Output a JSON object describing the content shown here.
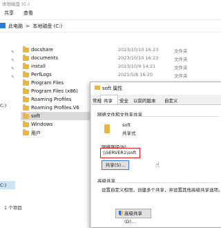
{
  "window": {
    "title": "本地磁盘 (C:)"
  },
  "ribbon": {
    "tabs": [
      "共享",
      "查看"
    ]
  },
  "address": {
    "crumbs": [
      "此电脑",
      ">",
      "本地磁盘 (C:)"
    ]
  },
  "nav": {
    "drive_top": "C:)",
    "drive_selected": "C:)"
  },
  "files": [
    {
      "name": "docshare",
      "date": "2023/10/10 16:23",
      "type": "文件夹",
      "selected": false
    },
    {
      "name": "documents",
      "date": "2023/10/10 16:23",
      "type": "文件夹",
      "selected": false
    },
    {
      "name": "install",
      "date": "2023/10/9 14:21",
      "type": "文件夹",
      "selected": false
    },
    {
      "name": "PerfLogs",
      "date": "2021/5/8 16:20",
      "type": "文件夹",
      "selected": false
    },
    {
      "name": "Program Files",
      "date": "",
      "type": "",
      "selected": false
    },
    {
      "name": "Program Files (x86)",
      "date": "",
      "type": "",
      "selected": false
    },
    {
      "name": "Roaming Profiles",
      "date": "",
      "type": "",
      "selected": false
    },
    {
      "name": "Roaming Profiles.V6",
      "date": "",
      "type": "",
      "selected": false
    },
    {
      "name": "soft",
      "date": "",
      "type": "",
      "selected": true
    },
    {
      "name": "Windows",
      "date": "",
      "type": "",
      "selected": false
    },
    {
      "name": "用户",
      "date": "",
      "type": "",
      "selected": false
    }
  ],
  "status": {
    "count": "1 个项目"
  },
  "dialog": {
    "title": "soft 属性",
    "tabs": [
      "常规",
      "共享",
      "安全",
      "以前的版本",
      "自定义"
    ],
    "active_tab": "共享",
    "group1_title": "网络文件和文件夹共享",
    "share_name": "soft",
    "share_state": "共享式",
    "path_label": "网络路径(N):",
    "path_value": "\\\\SERVER1\\soft",
    "share_button": "共享(S)...",
    "group2_title": "高级共享",
    "advanced_desc": "设置自定义权限，创建多个共享，并设置其他高级共享选项。",
    "advanced_button": "高级共享(D)..."
  },
  "colors": {
    "folder": "#e8b743",
    "selection": "#d9d9d9",
    "highlight_border": "#e02020",
    "accent": "#3a7bd5"
  }
}
